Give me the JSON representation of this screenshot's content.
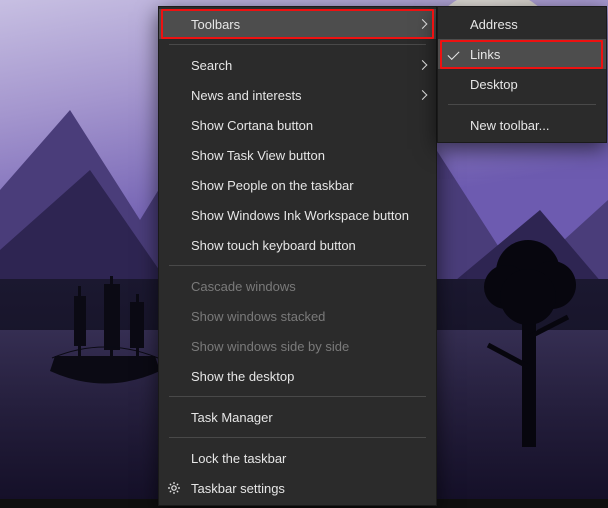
{
  "main_menu": {
    "toolbars": "Toolbars",
    "search": "Search",
    "news": "News and interests",
    "cortana": "Show Cortana button",
    "taskview": "Show Task View button",
    "people": "Show People on the taskbar",
    "ink": "Show Windows Ink Workspace button",
    "touchkb": "Show touch keyboard button",
    "cascade": "Cascade windows",
    "stacked": "Show windows stacked",
    "sidebyside": "Show windows side by side",
    "showdesktop": "Show the desktop",
    "taskmgr": "Task Manager",
    "lock": "Lock the taskbar",
    "settings": "Taskbar settings"
  },
  "sub_menu": {
    "address": "Address",
    "links": "Links",
    "desktop": "Desktop",
    "newtoolbar": "New toolbar..."
  }
}
